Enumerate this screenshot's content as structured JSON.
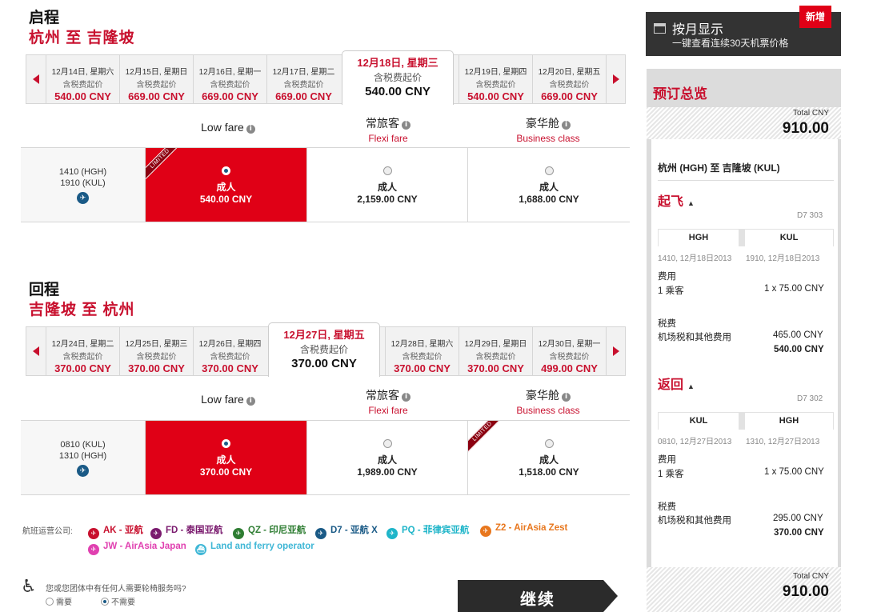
{
  "outbound": {
    "heading": "启程",
    "route": "杭州 至 吉隆坡",
    "dates": [
      {
        "date": "12月14日, 星期六",
        "label": "含税费起价",
        "price": "540.00 CNY"
      },
      {
        "date": "12月15日, 星期日",
        "label": "含税费起价",
        "price": "669.00 CNY"
      },
      {
        "date": "12月16日, 星期一",
        "label": "含税费起价",
        "price": "669.00 CNY"
      },
      {
        "date": "12月17日, 星期二",
        "label": "含税费起价",
        "price": "669.00 CNY"
      },
      {
        "date": "12月18日, 星期三",
        "label": "含税费起价",
        "price": "540.00 CNY"
      },
      {
        "date": "12月19日, 星期四",
        "label": "含税费起价",
        "price": "540.00 CNY"
      },
      {
        "date": "12月20日, 星期五",
        "label": "含税费起价",
        "price": "669.00 CNY"
      }
    ],
    "fare_headers": {
      "low": "Low fare",
      "flexi": "常旅客",
      "flexi_sub": "Flexi fare",
      "business": "豪华舱",
      "business_sub": "Business class"
    },
    "flight": {
      "depart": "1410  (HGH)",
      "arrive": "1910  (KUL)"
    },
    "fares": [
      {
        "pax": "成人",
        "price": "540.00 CNY",
        "ribbon": "LIMITED"
      },
      {
        "pax": "成人",
        "price": "2,159.00 CNY"
      },
      {
        "pax": "成人",
        "price": "1,688.00 CNY"
      }
    ]
  },
  "inbound": {
    "heading": "回程",
    "route": "吉隆坡 至 杭州",
    "dates": [
      {
        "date": "12月24日, 星期二",
        "label": "含税费起价",
        "price": "370.00 CNY"
      },
      {
        "date": "12月25日, 星期三",
        "label": "含税费起价",
        "price": "370.00 CNY"
      },
      {
        "date": "12月26日, 星期四",
        "label": "含税费起价",
        "price": "370.00 CNY"
      },
      {
        "date": "12月27日, 星期五",
        "label": "含税费起价",
        "price": "370.00 CNY"
      },
      {
        "date": "12月28日, 星期六",
        "label": "含税费起价",
        "price": "370.00 CNY"
      },
      {
        "date": "12月29日, 星期日",
        "label": "含税费起价",
        "price": "370.00 CNY"
      },
      {
        "date": "12月30日, 星期一",
        "label": "含税费起价",
        "price": "499.00 CNY"
      }
    ],
    "fare_headers": {
      "low": "Low fare",
      "flexi": "常旅客",
      "flexi_sub": "Flexi fare",
      "business": "豪华舱",
      "business_sub": "Business class"
    },
    "flight": {
      "depart": "0810  (KUL)",
      "arrive": "1310  (HGH)"
    },
    "fares": [
      {
        "pax": "成人",
        "price": "370.00 CNY"
      },
      {
        "pax": "成人",
        "price": "1,989.00 CNY"
      },
      {
        "pax": "成人",
        "price": "1,518.00 CNY",
        "ribbon": "LIMITED"
      }
    ]
  },
  "operators": {
    "label": "航班运营公司:",
    "items": [
      {
        "code": "AK",
        "name": "AK - 亚航",
        "color": "#c8102e"
      },
      {
        "code": "FD",
        "name": "FD - 泰国亚航",
        "color": "#7a1a6e"
      },
      {
        "code": "QZ",
        "name": "QZ - 印尼亚航",
        "color": "#2e7d32"
      },
      {
        "code": "D7",
        "name": "D7 - 亚航 X",
        "color": "#1a5a86"
      },
      {
        "code": "PQ",
        "name": "PQ - 菲律宾亚航",
        "color": "#1fb5c9"
      },
      {
        "code": "Z2",
        "name": "Z2 - AirAsia Zest",
        "color": "#e8771e"
      },
      {
        "code": "JW",
        "name": "JW - AirAsia Japan",
        "color": "#e040b0"
      },
      {
        "code": "LF",
        "name": "Land and ferry operator",
        "color": "#3fb7d6"
      }
    ]
  },
  "wheelchair": {
    "question": "您或您团体中有任何人需要轮椅服务吗?",
    "opt_yes": "需要",
    "opt_no": "不需要"
  },
  "continue_label": "继续",
  "monthly": {
    "title": "按月显示",
    "subtitle": "一键查看连续30天机票价格",
    "badge": "新增"
  },
  "summary": {
    "title": "预订总览",
    "total_label": "Total CNY",
    "total_value": "910.00",
    "route": "杭州 (HGH) 至 吉隆坡 (KUL)",
    "depart": {
      "title": "起飞",
      "flight_no": "D7 303",
      "from": "HGH",
      "to": "KUL",
      "from_time": "1410, 12月18日2013",
      "to_time": "1910, 12月18日2013",
      "fee_label": "费用",
      "pax": "1 乘客",
      "pax_fee": "1 x 75.00 CNY",
      "tax_label": "税费",
      "tax_desc": "机场税和其他费用",
      "tax_value": "465.00 CNY",
      "subtotal": "540.00 CNY"
    },
    "return": {
      "title": "返回",
      "flight_no": "D7 302",
      "from": "KUL",
      "to": "HGH",
      "from_time": "0810, 12月27日2013",
      "to_time": "1310, 12月27日2013",
      "fee_label": "费用",
      "pax": "1 乘客",
      "pax_fee": "1 x 75.00 CNY",
      "tax_label": "税费",
      "tax_desc": "机场税和其他费用",
      "tax_value": "295.00 CNY",
      "subtotal": "370.00 CNY"
    },
    "footer_total_label": "Total CNY",
    "footer_total_value": "910.00"
  }
}
